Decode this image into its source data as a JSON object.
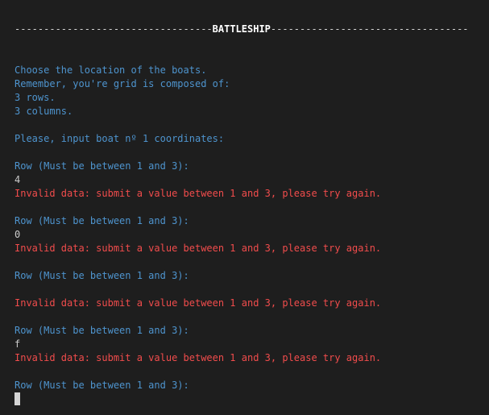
{
  "terminal": {
    "title_left": "----------------------------------",
    "title": "BATTLESHIP",
    "title_right": "----------------------------------",
    "intro": [
      "Choose the location of the boats.",
      "Remember, you're grid is composed of:",
      "3 rows.",
      "3 columns."
    ],
    "boat_prompt": "Please, input boat nº 1 coordinates:",
    "attempts": [
      {
        "prompt": "Row (Must be between 1 and 3):",
        "input": "4",
        "error": "Invalid data: submit a value between 1 and 3, please try again."
      },
      {
        "prompt": "Row (Must be between 1 and 3):",
        "input": "0",
        "error": "Invalid data: submit a value between 1 and 3, please try again."
      },
      {
        "prompt": "Row (Must be between 1 and 3):",
        "input": "",
        "error": "Invalid data: submit a value between 1 and 3, please try again."
      },
      {
        "prompt": "Row (Must be between 1 and 3):",
        "input": "f",
        "error": "Invalid data: submit a value between 1 and 3, please try again."
      }
    ],
    "final_prompt": "Row (Must be between 1 and 3):",
    "colors": {
      "background": "#1e1e1e",
      "info": "#4e94ce",
      "input": "#cccccc",
      "error": "#f14c4c"
    }
  }
}
